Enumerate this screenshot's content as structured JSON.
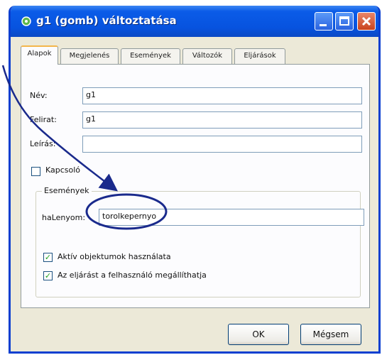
{
  "window": {
    "title": "g1 (gomb) változtatása"
  },
  "tabs": [
    "Alapok",
    "Megjelenés",
    "Események",
    "Változók",
    "Eljárások"
  ],
  "fields": {
    "nev": {
      "label": "Név:",
      "value": "g1"
    },
    "felirat": {
      "label": "Felirat:",
      "value": "g1"
    },
    "leiras": {
      "label": "Leírás:",
      "value": ""
    }
  },
  "kapcsolo": {
    "label": "Kapcsoló",
    "checked": false
  },
  "events_group": {
    "title": "Események",
    "handler": {
      "label": "haLenyom:",
      "value": "torolkepernyo"
    },
    "options": [
      {
        "label": "Aktív objektumok használata",
        "checked": true
      },
      {
        "label": "Az eljárást a felhasználó megállíthatja",
        "checked": true
      }
    ]
  },
  "buttons": {
    "ok": "OK",
    "cancel": "Mégsem"
  },
  "colors": {
    "title_bar": "#0753df",
    "dialog_face": "#ece9d8",
    "annotation": "#1a2a8c"
  }
}
